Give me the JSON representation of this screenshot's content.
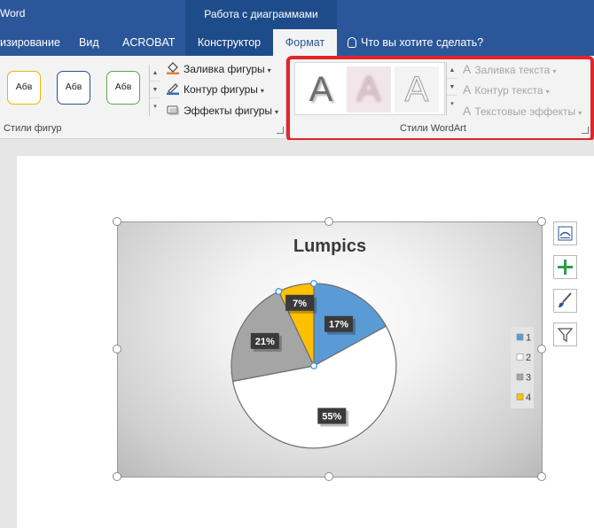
{
  "titlebar": {
    "app_title": "Word",
    "context_group": "Работа с диаграммами"
  },
  "tabs": [
    {
      "label": "изирование"
    },
    {
      "label": "Вид"
    },
    {
      "label": "ACROBAT"
    },
    {
      "label": "Конструктор"
    },
    {
      "label": "Формат"
    }
  ],
  "search_tab": {
    "label": "Что вы хотите сделать?",
    "icon": "lightbulb-icon"
  },
  "shape_styles": {
    "items": [
      {
        "label": "Абв",
        "border": "#e6b800"
      },
      {
        "label": "Абв",
        "border": "#2f4f8f"
      },
      {
        "label": "Абв",
        "border": "#5aa84a"
      }
    ],
    "group_label": "Стили фигур"
  },
  "shape_commands": [
    {
      "label": "Заливка фигуры",
      "icon": "paint-bucket-icon"
    },
    {
      "label": "Контур фигуры",
      "icon": "pen-outline-icon"
    },
    {
      "label": "Эффекты фигуры",
      "icon": "effects-icon"
    }
  ],
  "wordart": {
    "group_label": "Стили WordArt",
    "gallery": [
      {
        "glyph": "A",
        "style": "gradient-shadow"
      },
      {
        "glyph": "A",
        "style": "pink-glow"
      },
      {
        "glyph": "A",
        "style": "outline-gray"
      }
    ],
    "commands": [
      {
        "label": "Заливка текста"
      },
      {
        "label": "Контур текста"
      },
      {
        "label": "Текстовые эффекты"
      }
    ],
    "highlight_color": "#e0262a"
  },
  "chart_data": {
    "type": "pie",
    "title": "Lumpics",
    "categories": [
      "1",
      "2",
      "3",
      "4"
    ],
    "values": [
      17,
      55,
      21,
      7
    ],
    "data_labels": [
      "17%",
      "55%",
      "21%",
      "7%"
    ],
    "colors": [
      "#5b9bd5",
      "#ffffff",
      "#a5a5a5",
      "#ffc000"
    ],
    "legend": "right",
    "selected_point": "4"
  },
  "side_buttons": [
    {
      "name": "layout-options-icon"
    },
    {
      "name": "chart-elements-plus-icon"
    },
    {
      "name": "chart-styles-brush-icon"
    },
    {
      "name": "chart-filters-icon"
    }
  ]
}
